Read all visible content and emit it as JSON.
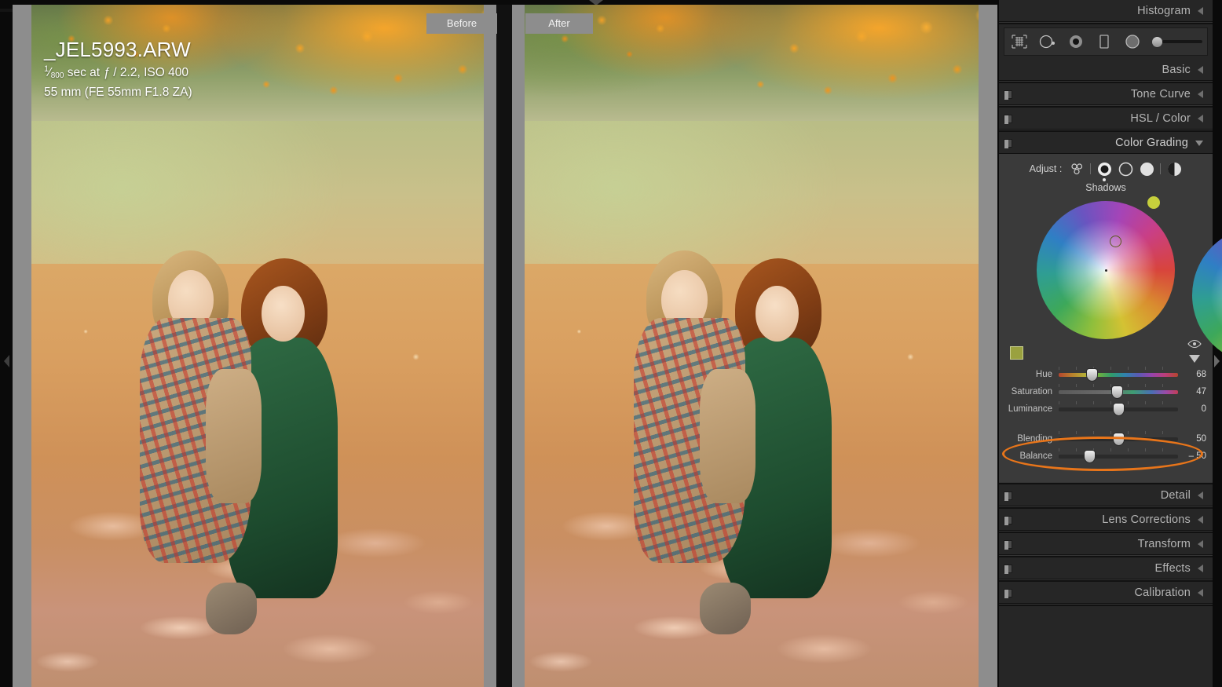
{
  "viewer": {
    "before_label": "Before",
    "after_label": "After",
    "metadata": {
      "filename": "_JEL5993.ARW",
      "shutter_numerator": "1",
      "shutter_denominator": "800",
      "exposure_rest": " sec at ",
      "aperture_symbol": "ƒ",
      "aperture": " / 2.2, ISO 400",
      "lens": "55 mm (FE 55mm F1.8 ZA)"
    }
  },
  "panels": {
    "histogram": "Histogram",
    "basic": "Basic",
    "tone_curve": "Tone Curve",
    "hsl_color": "HSL / Color",
    "color_grading": "Color Grading",
    "detail": "Detail",
    "lens_corrections": "Lens Corrections",
    "transform": "Transform",
    "effects": "Effects",
    "calibration": "Calibration"
  },
  "tools": [
    "crop-overlay-icon",
    "spot-removal-icon",
    "red-eye-icon",
    "masking-rect-icon",
    "radial-filter-icon",
    "tool-amount-slider"
  ],
  "color_grading": {
    "adjust_label": "Adjust :",
    "adjust_options": [
      "all-wheels-icon",
      "shadows-icon",
      "midtones-icon",
      "highlights-icon",
      "global-icon"
    ],
    "adjust_selected": "shadows-icon",
    "wheel_title": "Shadows",
    "swatch_color": "#9aa13f",
    "handle_color": "#c6cf3c",
    "sliders": [
      {
        "name": "Hue",
        "value": "68",
        "pos": 28
      },
      {
        "name": "Saturation",
        "value": "47",
        "pos": 49
      },
      {
        "name": "Luminance",
        "value": "0",
        "pos": 50
      }
    ],
    "sliders2": [
      {
        "name": "Blending",
        "value": "50",
        "pos": 50
      },
      {
        "name": "Balance",
        "value": "– 50",
        "pos": 26
      }
    ],
    "highlight_color": "#e8751a"
  }
}
